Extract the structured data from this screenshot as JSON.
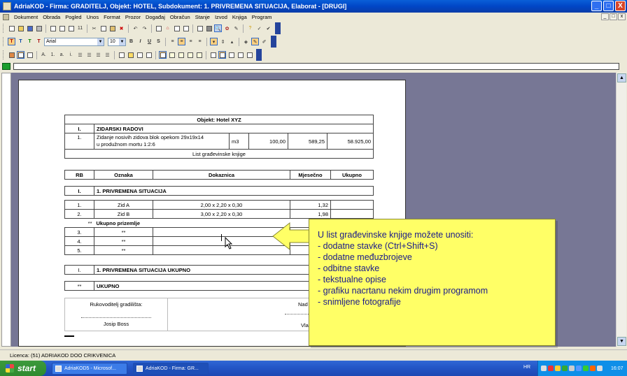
{
  "window": {
    "title": "AdriaKOD - Firma: GRADITELJ,  Objekt: HOTEL,  Subdokument: 1. PRIVREMENA SITUACIJA,  Elaborat - [DRUGI]",
    "minimize": "_",
    "maximize": "□",
    "close": "X"
  },
  "menu": {
    "items": [
      "Dokument",
      "Obrada",
      "Pogled",
      "Unos",
      "Format",
      "Prozor",
      "Događaj",
      "Obračun",
      "Stanje",
      "Izvod",
      "Knjiga",
      "Program"
    ],
    "mdi_min": "_",
    "mdi_restore": "□",
    "mdi_close": "x"
  },
  "format_toolbar": {
    "font_name": "Arial",
    "font_size": "10",
    "bold": "B",
    "italic": "I",
    "underline": "U",
    "strike": "S"
  },
  "style_toolbar": {
    "t_buttons": [
      "T",
      "T",
      "T",
      "T"
    ]
  },
  "document": {
    "header_table": {
      "title": "Objekt: Hotel XYZ",
      "section_num": "I.",
      "section_name": "ZIDARSKI RADOVI",
      "item_num": "1.",
      "item_desc_1": "Zidanje nosivih zidova blok opekom 29x19x14",
      "item_desc_2": "u produžnom mortu 1:2:6",
      "unit": "m3",
      "qty": "100,00",
      "price": "589,25",
      "total": "58.925,00",
      "caption": "List građevinske knjige"
    },
    "columns": [
      "RB",
      "Oznaka",
      "Dokaznica",
      "Mjesečno",
      "Ukupno"
    ],
    "situation_num": "I.",
    "situation_name": "1. PRIVREMENA SITUACIJA",
    "rows": [
      {
        "rb": "1.",
        "oznaka": "Zid A",
        "dokaznica": "2,00 x 2,20 x 0,30",
        "mjesecno": "1,32",
        "ukupno": ""
      },
      {
        "rb": "2.",
        "oznaka": "Zid B",
        "dokaznica": "3,00 x 2,20 x 0,30",
        "mjesecno": "1,98",
        "ukupno": ""
      }
    ],
    "subtotal_mark": "**",
    "subtotal_label": "Ukupno prizemlje",
    "empty_rows": [
      {
        "rb": "3.",
        "oznaka": "**"
      },
      {
        "rb": "4.",
        "oznaka": "**"
      },
      {
        "rb": "5.",
        "oznaka": "**"
      }
    ],
    "situation_total_num": "I.",
    "situation_total_label": "1. PRIVREMENA SITUACIJA UKUPNO",
    "grand_mark": "**",
    "grand_label": "UKUPNO",
    "sign_left_role": "Rukovoditelj gradilišta:",
    "sign_left_name": "Josip Boss",
    "sign_right_role": "Nad",
    "sign_right_name": "Vla"
  },
  "callout": {
    "lines": [
      "U list građevinske knjige možete unositi:",
      "- dodatne stavke (Ctrl+Shift+S)",
      "- dodatne međuzbrojeve",
      "- odbitne stavke",
      "- tekstualne opise",
      "- grafiku nacrtanu nekim drugim programom",
      "- snimljene fotografije"
    ]
  },
  "status": {
    "text": "Licenca: (51) ADRIAKOD DOO CRIKVENICA"
  },
  "taskbar": {
    "start": "start",
    "tasks": [
      "AdriaKOD5 - Microsof...",
      "AdriaKOD - Firma: GR..."
    ],
    "lang": "HR",
    "clock": "16:07"
  }
}
